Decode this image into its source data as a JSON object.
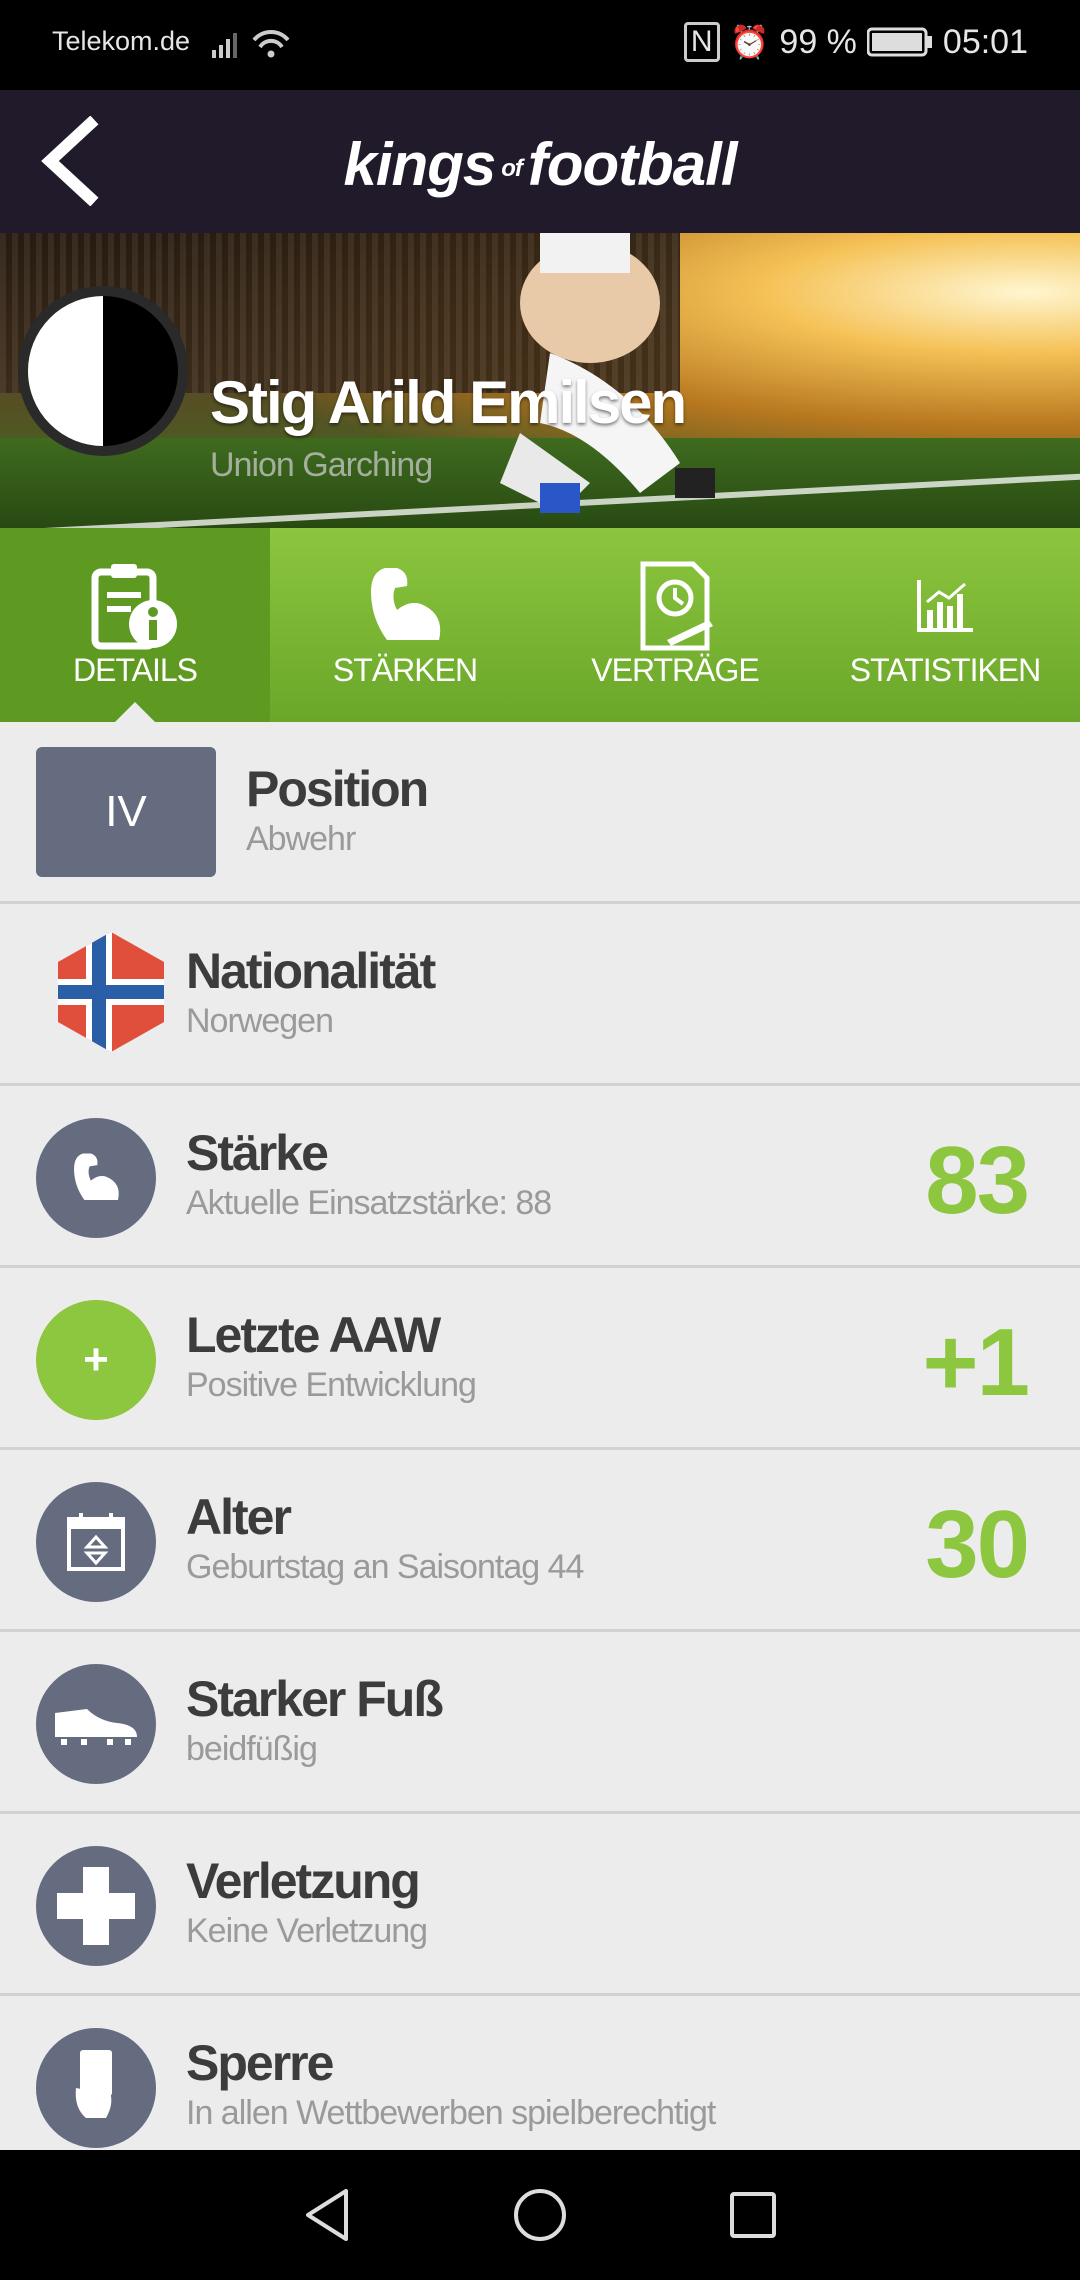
{
  "status_bar": {
    "carrier": "Telekom.de",
    "battery": "99 %",
    "time": "05:01"
  },
  "app_bar": {
    "logo_left": "kings",
    "logo_of": "of",
    "logo_right": "football"
  },
  "player": {
    "name": "Stig Arild Emilsen",
    "club": "Union Garching"
  },
  "tabs": [
    {
      "label": "DETAILS",
      "icon": "document-info-icon",
      "active": true
    },
    {
      "label": "STÄRKEN",
      "icon": "flexed-arm-icon"
    },
    {
      "label": "VERTRÄGE",
      "icon": "contract-clock-icon"
    },
    {
      "label": "STATISTIKEN",
      "icon": "bar-chart-icon"
    }
  ],
  "rows": {
    "position": {
      "badge": "IV",
      "title": "Position",
      "sub": "Abwehr"
    },
    "nationality": {
      "title": "Nationalität",
      "sub": "Norwegen"
    },
    "strength": {
      "title": "Stärke",
      "sub": "Aktuelle Einsatzstärke: 88",
      "value": "83"
    },
    "aaw": {
      "title": "Letzte AAW",
      "sub": "Positive Entwicklung",
      "value": "+1",
      "icon_text": "+"
    },
    "age": {
      "title": "Alter",
      "sub": "Geburtstag an Saisontag 44",
      "value": "30"
    },
    "foot": {
      "title": "Starker Fuß",
      "sub": "beidfüßig"
    },
    "injury": {
      "title": "Verletzung",
      "sub": "Keine Verletzung"
    },
    "ban": {
      "title": "Sperre",
      "sub": "In allen Wettbewerben spielberechtigt"
    }
  },
  "colors": {
    "accent_green": "#8dc63f",
    "app_bar": "#211a2b",
    "icon_grey": "#656c7f"
  }
}
